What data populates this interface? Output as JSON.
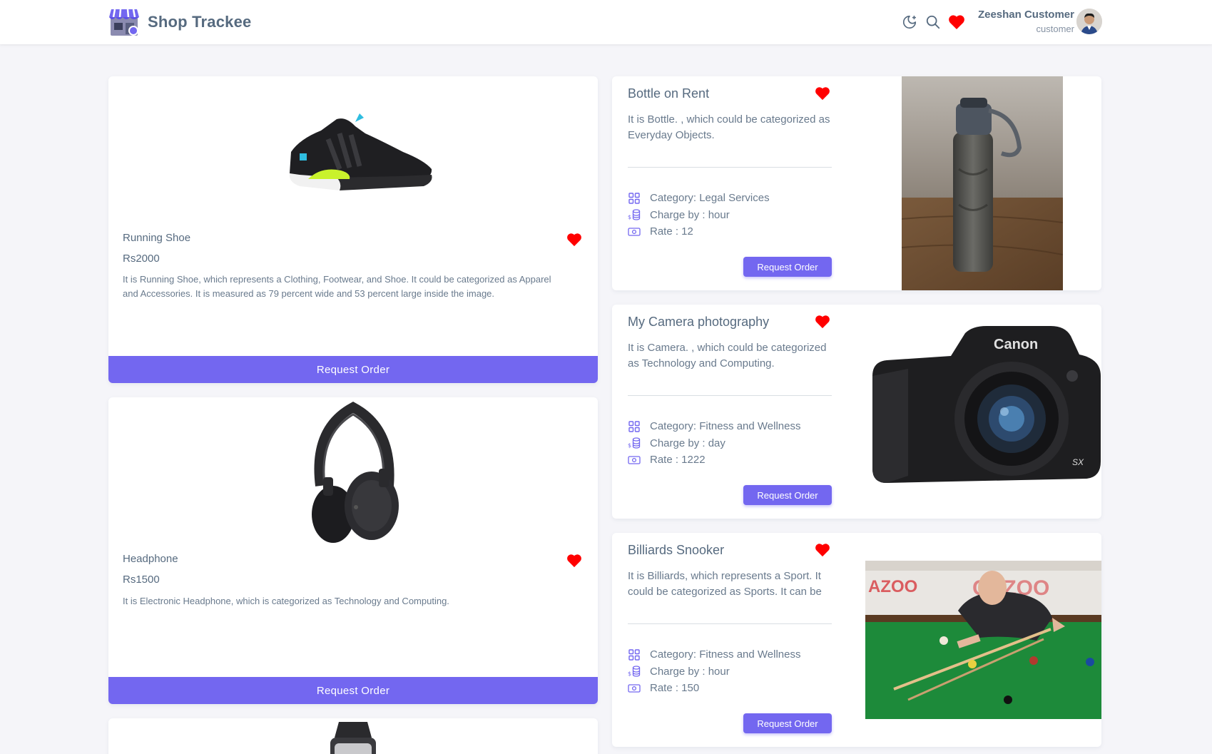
{
  "navbar": {
    "brand_name": "Shop Trackee",
    "user_name": "Zeeshan Customer",
    "user_role": "customer"
  },
  "colors": {
    "accent": "#7367f0",
    "heart": "#ff0000",
    "text": "#566a7f",
    "background": "#f5f5f9"
  },
  "products": [
    {
      "title": "Running Shoe",
      "price": "Rs2000",
      "description": "It is Running Shoe, which represents a Clothing, Footwear, and Shoe. It could be categorized as Apparel and Accessories. It is measured as 79 percent wide and 53 percent large inside the image.",
      "button": "Request Order",
      "favorited": true
    },
    {
      "title": "Headphone",
      "price": "Rs1500",
      "description": "It is Electronic Headphone, which is categorized as Technology and Computing.",
      "button": "Request Order",
      "favorited": true
    }
  ],
  "services": [
    {
      "title": "Bottle on Rent",
      "description": "It is Bottle. , which could be categorized as Everyday Objects.",
      "category": "Category: Legal Services",
      "charge": "Charge by : hour",
      "rate": "Rate : 12",
      "button": "Request Order",
      "favorited": true
    },
    {
      "title": "My Camera photography",
      "description": "It is Camera. , which could be categorized as Technology and Computing.",
      "category": "Category: Fitness and Wellness",
      "charge": "Charge by : day",
      "rate": "Rate : 1222",
      "button": "Request Order",
      "favorited": true
    },
    {
      "title": "Billiards Snooker",
      "description": "It is Billiards, which represents a Sport. It could be categorized as Sports. It can be identified as \"Billiards Room\" label.",
      "category": "Category: Fitness and Wellness",
      "charge": "Charge by : hour",
      "rate": "Rate : 150",
      "button": "Request Order",
      "favorited": true
    }
  ],
  "icons": {
    "theme": "moon-icon",
    "search": "search-icon",
    "favorites": "heart-icon",
    "category": "grid-icon",
    "charge": "coins-icon",
    "rate": "cash-icon"
  }
}
